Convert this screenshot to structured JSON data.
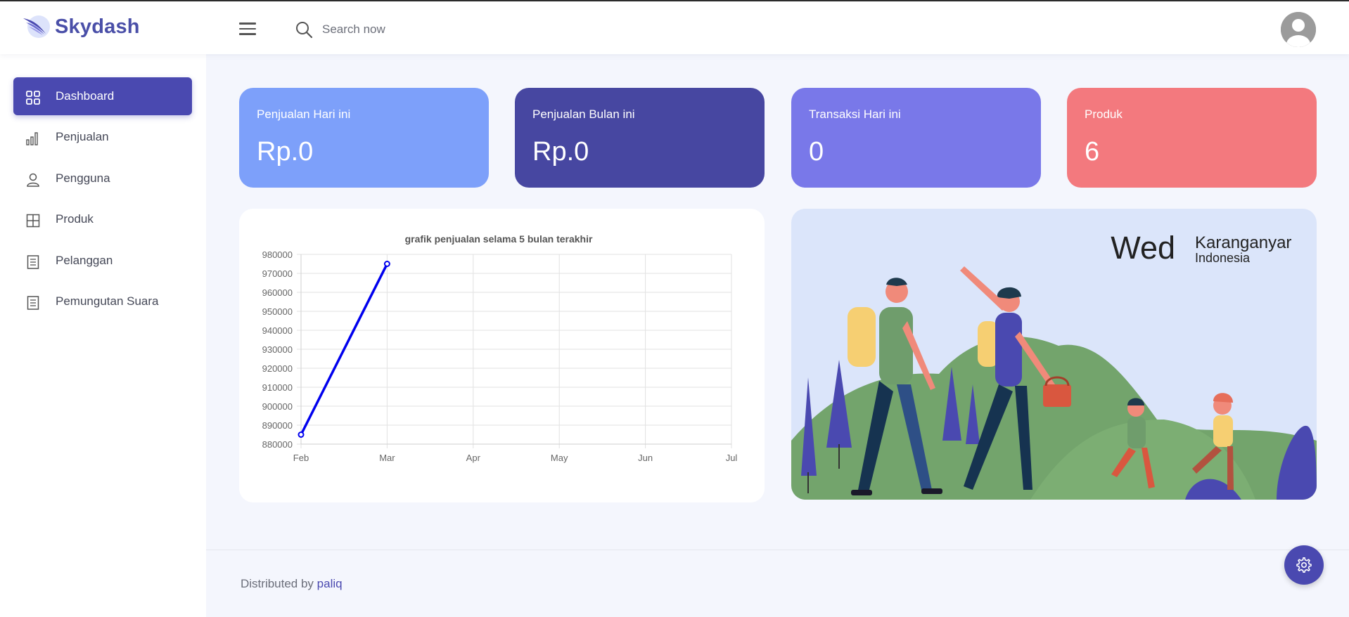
{
  "brand": {
    "name": "Skydash",
    "accent": "#4a49b0"
  },
  "header": {
    "menu_icon": "hamburger-icon",
    "search": {
      "icon": "search-icon",
      "placeholder": "Search now"
    },
    "avatar_icon": "user-avatar-icon"
  },
  "sidebar": {
    "items": [
      {
        "label": "Dashboard",
        "icon": "grid-icon",
        "active": true
      },
      {
        "label": "Penjualan",
        "icon": "bar-chart-icon",
        "active": false
      },
      {
        "label": "Pengguna",
        "icon": "user-icon",
        "active": false
      },
      {
        "label": "Produk",
        "icon": "table-icon",
        "active": false
      },
      {
        "label": "Pelanggan",
        "icon": "document-icon",
        "active": false
      },
      {
        "label": "Pemungutan Suara",
        "icon": "document-icon",
        "active": false
      }
    ]
  },
  "cards": [
    {
      "title": "Penjualan Hari ini",
      "value": "Rp.0",
      "color": "#7da0fa"
    },
    {
      "title": "Penjualan Bulan ini",
      "value": "Rp.0",
      "color": "#4747a1"
    },
    {
      "title": "Transaksi Hari ini",
      "value": "0",
      "color": "#7978e9"
    },
    {
      "title": "Produk",
      "value": "6",
      "color": "#f3797e"
    }
  ],
  "chart_data": {
    "type": "line",
    "title": "grafik penjualan selama 5 bulan terakhir",
    "categories": [
      "Feb",
      "Mar",
      "Apr",
      "May",
      "Jun",
      "Jul"
    ],
    "series": [
      {
        "values": [
          885000,
          975000,
          null,
          null,
          null,
          null
        ],
        "color": "#0000ee"
      }
    ],
    "ylim": [
      880000,
      980000
    ],
    "yticks": [
      980000,
      970000,
      960000,
      950000,
      940000,
      930000,
      920000,
      910000,
      900000,
      890000,
      880000
    ],
    "grid": true,
    "legend": "none"
  },
  "weather": {
    "day": "Wed",
    "city": "Karanganyar",
    "country": "Indonesia"
  },
  "footer": {
    "prefix": "Distributed by",
    "link": "paliq"
  },
  "settings_icon": "gear-icon"
}
